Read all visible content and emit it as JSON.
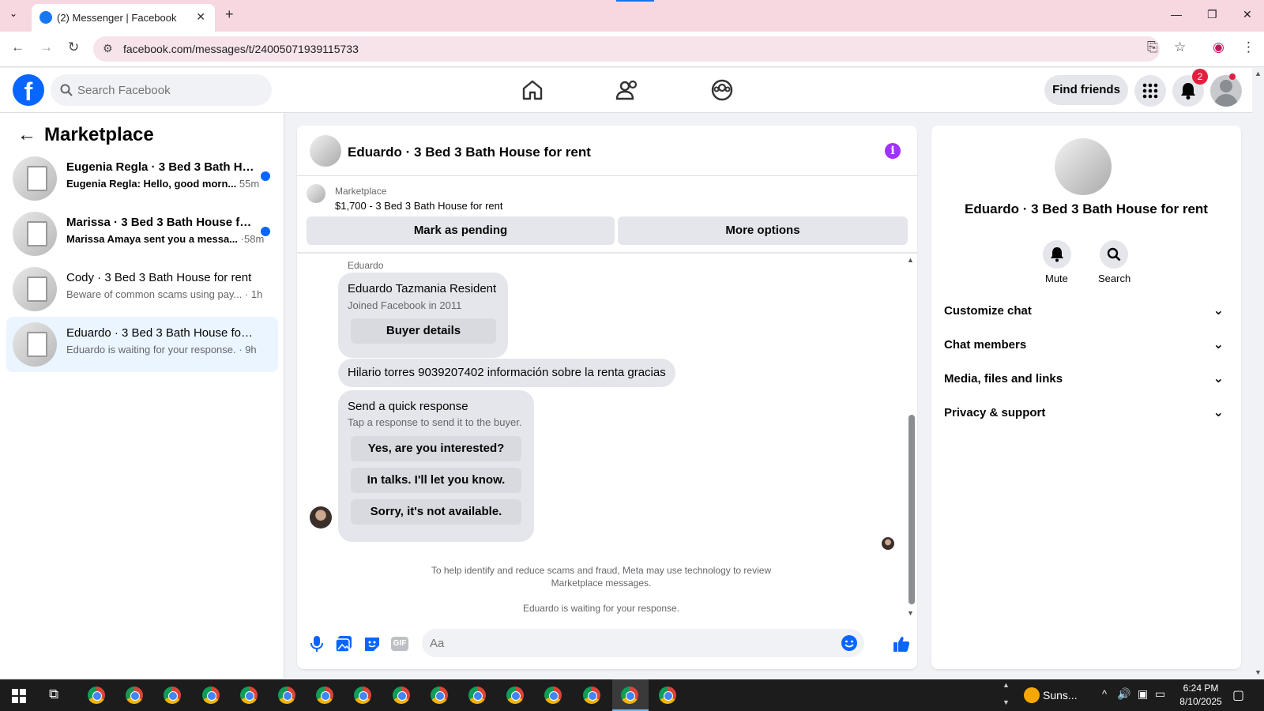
{
  "browser": {
    "tab_title": "(2) Messenger | Facebook",
    "url": "facebook.com/messages/t/24005071939115733"
  },
  "header": {
    "search_placeholder": "Search Facebook",
    "find_friends": "Find friends",
    "notification_count": "2",
    "brand_color": "#0866ff"
  },
  "sidebar": {
    "title": "Marketplace",
    "conversations": [
      {
        "name": "Eugenia Regla · 3 Bed 3 Bath Ho...",
        "preview": "Eugenia Regla: Hello, good morn...",
        "time": "55m",
        "unread": true
      },
      {
        "name": "Marissa · 3 Bed 3 Bath House for...",
        "preview": "Marissa Amaya sent you a messa...",
        "time": "·58m",
        "unread": true
      },
      {
        "name": "Cody · 3 Bed 3 Bath House for rent",
        "preview": "Beware of common scams using pay...",
        "time": "· 1h",
        "unread": false
      },
      {
        "name": "Eduardo · 3 Bed 3 Bath House for r...",
        "preview": "Eduardo is waiting for your response.",
        "time": "· 9h",
        "unread": false
      }
    ]
  },
  "chat": {
    "title": "Eduardo · 3 Bed 3 Bath House for rent",
    "listing_label": "Marketplace",
    "listing_price_title": "$1,700 - 3 Bed 3 Bath House for rent",
    "mark_pending": "Mark as pending",
    "more_options": "More options",
    "sender_name": "Eduardo",
    "profile_card": {
      "name": "Eduardo Tazmania Resident",
      "joined": "Joined Facebook in 2011",
      "button": "Buyer details"
    },
    "message": "Hilario torres 9039207402 información  sobre la renta gracias",
    "quick_response": {
      "title": "Send a quick response",
      "subtitle": "Tap a response to send it to the buyer.",
      "options": [
        "Yes, are you interested?",
        "In talks. I'll let you know.",
        "Sorry, it's not available."
      ]
    },
    "notice": "To help identify and reduce scams and fraud, Meta may use technology to review Marketplace messages.",
    "waiting": "Eduardo is waiting for your response.",
    "composer_placeholder": "Aa"
  },
  "details": {
    "name": "Eduardo · 3 Bed 3 Bath House for rent",
    "mute": "Mute",
    "search": "Search",
    "sections": [
      "Customize chat",
      "Chat members",
      "Media, files and links",
      "Privacy & support"
    ]
  },
  "taskbar": {
    "weather": "Suns...",
    "time": "6:24 PM",
    "date": "8/10/2025"
  }
}
